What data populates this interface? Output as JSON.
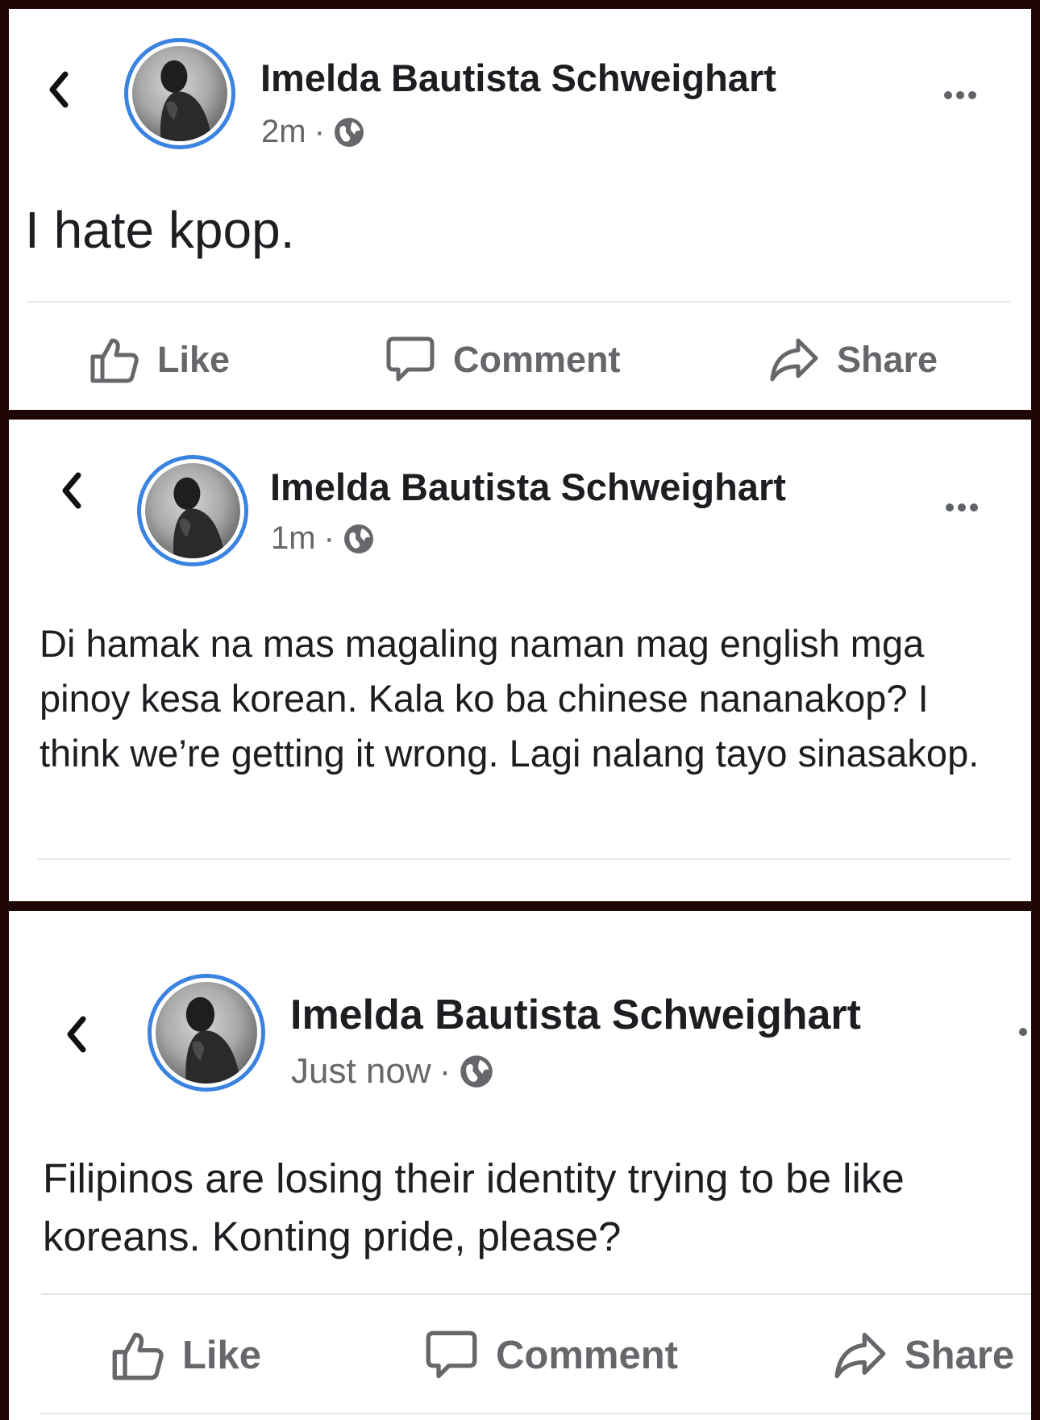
{
  "posts": [
    {
      "author": "Imelda Bautista Schweighart",
      "time": "2m",
      "separator": "·",
      "text": "I hate kpop."
    },
    {
      "author": "Imelda Bautista Schweighart",
      "time": "1m",
      "separator": "·",
      "text": "Di hamak na mas magaling naman mag english mga pinoy kesa korean. Kala ko ba chinese nananakop? I think we’re getting it wrong. Lagi nalang tayo sinasakop."
    },
    {
      "author": "Imelda Bautista Schweighart",
      "time": "Just now",
      "separator": "·",
      "text": "Filipinos are losing their identity trying to be like koreans. Konting pride, please?"
    }
  ],
  "actions": {
    "like": "Like",
    "comment": "Comment",
    "share": "Share"
  },
  "icons": {
    "back": "chevron-left-icon",
    "more": "more-dots-icon",
    "audience": "globe-icon",
    "like": "thumbs-up-icon",
    "comment": "comment-bubble-icon",
    "share": "share-arrow-icon"
  },
  "colors": {
    "frame": "#1f0606",
    "avatar_ring": "#3b83e0",
    "text": "#1c1e21",
    "secondary_text": "#65676b"
  }
}
